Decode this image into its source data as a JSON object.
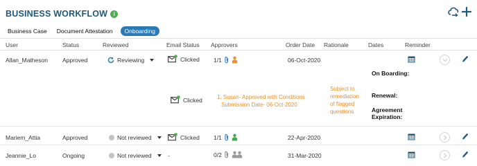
{
  "app": {
    "title": "BUSINESS WORKFLOW",
    "info_glyph": "i",
    "accent_color": "#1d5a80",
    "header_actions": [
      {
        "name": "workflow-cloud-icon"
      },
      {
        "name": "add-icon"
      }
    ]
  },
  "tabs": [
    {
      "label": "Business Case",
      "active": false
    },
    {
      "label": "Document Attestation",
      "active": false
    },
    {
      "label": "Onboarding",
      "active": true
    }
  ],
  "columns": [
    "User",
    "Status",
    "Reviewed",
    "Email Status",
    "Approvers",
    "Order Date",
    "Rationale",
    "Dates",
    "Reminder"
  ],
  "rows": [
    {
      "user": "Allan_Matheson",
      "status": "Approved",
      "reviewed": "Reviewing",
      "reviewed_icon": "refresh-icon",
      "email_status": "Clicked",
      "approvers": "1/1",
      "approver_icon": "person-icon",
      "approver_color": "#ef8f2c",
      "order_date": "06-Oct-2020",
      "expanded": {
        "email_status": "Clicked",
        "approver_note_line1": "1. Susan- Approved with Conditions",
        "approver_note_line2": "Submission Date- 06-Oct-2020",
        "rationale": "Subject to remediation of flagged questions",
        "dates": [
          {
            "label": "On Boarding:",
            "value": ""
          },
          {
            "label": "Renewal:",
            "value": ""
          },
          {
            "label": "Agreement Expiration:",
            "value": ""
          }
        ]
      }
    },
    {
      "user": "Mariem_Attia",
      "status": "Approved",
      "reviewed": "Not reviewed",
      "reviewed_icon": "not-reviewed-icon",
      "email_status": "Clicked",
      "approvers": "1/1",
      "approver_icon": "person-icon",
      "approver_color": "#3fa950",
      "order_date": "22-Apr-2020"
    },
    {
      "user": "Jeannie_Lo",
      "status": "Ongoing",
      "reviewed": "Not reviewed",
      "reviewed_icon": "not-reviewed-icon",
      "email_status": "-",
      "approvers": "0/2",
      "approver_icon": "people-icon",
      "approver_color": "#9a9a9a",
      "order_date": "31-Mar-2020"
    }
  ],
  "colors": {
    "active_tab": "#2a7ab8",
    "orange_text": "#e98f2a",
    "icon_blue": "#1d5a80",
    "green": "#4caf50"
  }
}
